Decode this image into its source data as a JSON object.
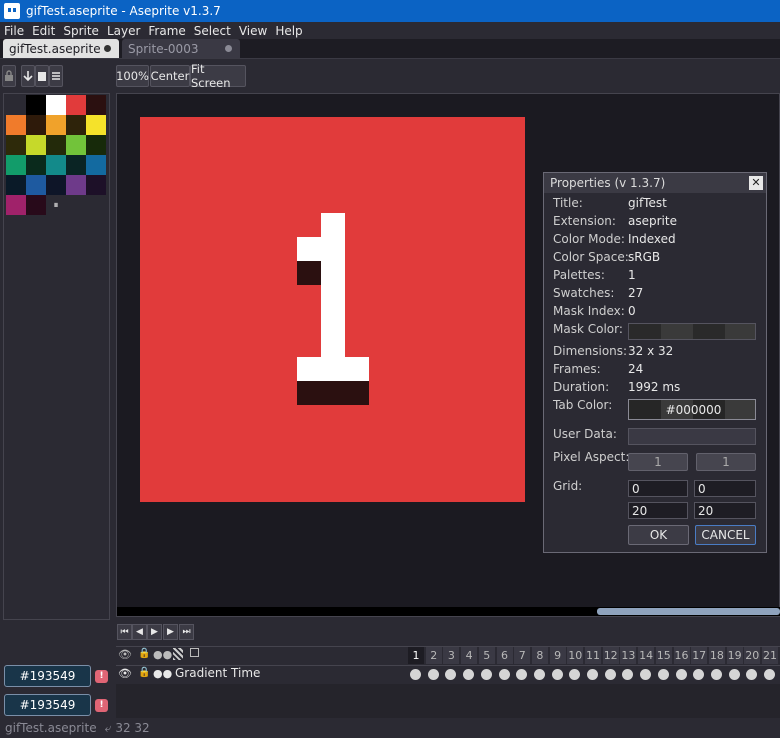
{
  "window": {
    "title": "gifTest.aseprite - Aseprite v1.3.7"
  },
  "menu": [
    "File",
    "Edit",
    "Sprite",
    "Layer",
    "Frame",
    "Select",
    "View",
    "Help"
  ],
  "tabs": [
    {
      "label": "gifTest.aseprite",
      "active": true
    },
    {
      "label": "Sprite-0003",
      "active": false
    }
  ],
  "toolbar": {
    "zoom": "100%",
    "center": "Center",
    "fit": "Fit Screen"
  },
  "palette": {
    "swatches": [
      "#2b2a33",
      "#000000",
      "#ffffff",
      "#e13b3b",
      "#2b1010",
      "#f07b2b",
      "#2e1a0a",
      "#f0a22b",
      "#2e230a",
      "#f5e22a",
      "#2e2a0a",
      "#c6d92a",
      "#232a0a",
      "#72c33a",
      "#172a0a",
      "#129c6a",
      "#0a2a1c",
      "#138a8a",
      "#0a2424",
      "#136aa0",
      "#0a1a28",
      "#1e5aa0",
      "#0e1528",
      "#6e3a8a",
      "#1d1028",
      "#a0226a",
      "#280a1a"
    ],
    "more_icon": "pause-icon"
  },
  "colors": {
    "accent": "#193549",
    "canvas_bg": "#e13b3b",
    "digit": "#ffffff",
    "digit_shadow": "#2b1010"
  },
  "properties": {
    "title": "Properties (v 1.3.7)",
    "rows": [
      {
        "label": "Title:",
        "value": "gifTest"
      },
      {
        "label": "Extension:",
        "value": "aseprite"
      },
      {
        "label": "Color Mode:",
        "value": "Indexed"
      },
      {
        "label": "Color Space:",
        "value": "sRGB"
      },
      {
        "label": "Palettes:",
        "value": "1"
      },
      {
        "label": "Swatches:",
        "value": "27"
      },
      {
        "label": "Mask Index:",
        "value": "0"
      }
    ],
    "mask_color_label": "Mask Color:",
    "rows2": [
      {
        "label": "Dimensions:",
        "value": "32 x 32"
      },
      {
        "label": "Frames:",
        "value": "24"
      },
      {
        "label": "Duration:",
        "value": "1992 ms"
      }
    ],
    "tab_color_label": "Tab Color:",
    "tab_color_value": "#000000",
    "user_data_label": "User Data:",
    "pixel_aspect_label": "Pixel Aspect:",
    "pixel_aspect": [
      "1",
      "1"
    ],
    "grid_label": "Grid:",
    "grid": [
      "0",
      "0",
      "20",
      "20"
    ],
    "ok": "OK",
    "cancel": "CANCEL"
  },
  "timeline": {
    "layer_name": "Gradient Time",
    "frames": [
      "1",
      "2",
      "3",
      "4",
      "5",
      "6",
      "7",
      "8",
      "9",
      "10",
      "11",
      "12",
      "13",
      "14",
      "15",
      "16",
      "17",
      "18",
      "19",
      "20",
      "21"
    ],
    "current_frame": "1"
  },
  "fg_color": "#193549",
  "bg_color": "#193549",
  "status": {
    "file": "gifTest.aseprite",
    "size": "32 32"
  }
}
